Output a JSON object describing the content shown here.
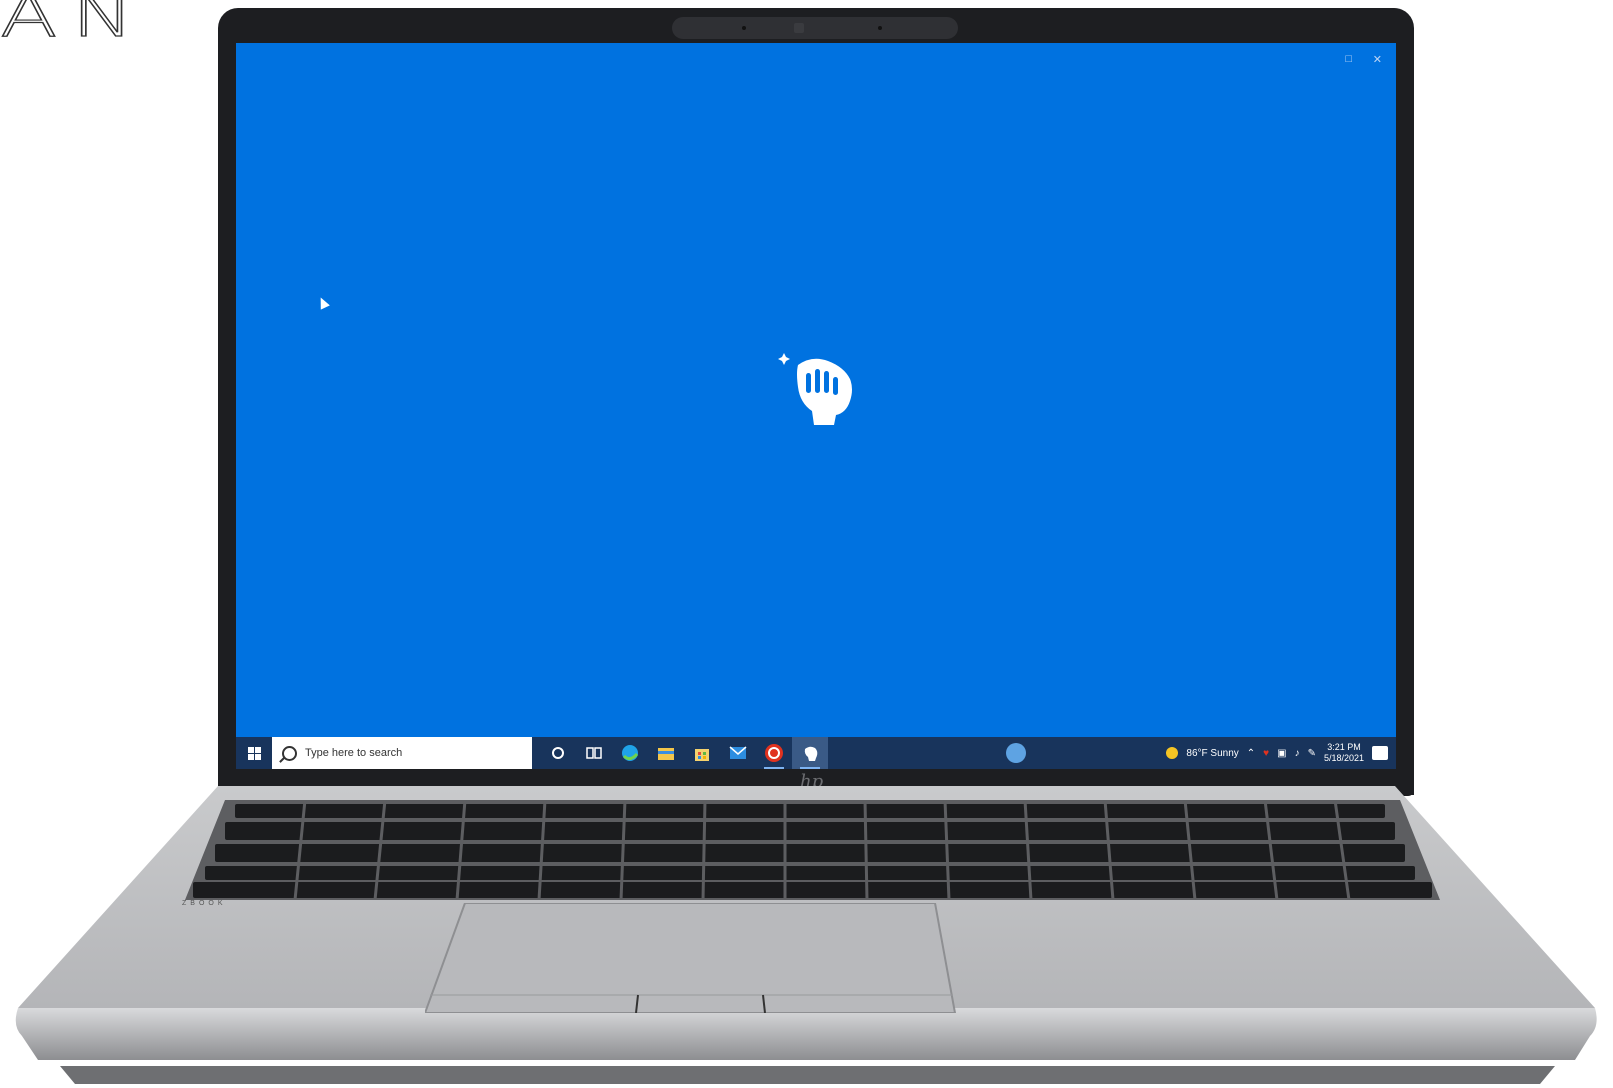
{
  "brand_fragment": "AN",
  "screen": {
    "background_color": "#0072e0",
    "window_controls": [
      "restore-icon",
      "close-icon"
    ],
    "center_icon": "clean-hand-icon"
  },
  "taskbar": {
    "search_placeholder": "Type here to search",
    "apps": [
      {
        "icon": "cortana-icon"
      },
      {
        "icon": "task-view-icon"
      },
      {
        "icon": "edge-icon"
      },
      {
        "icon": "file-explorer-icon"
      },
      {
        "icon": "store-icon"
      },
      {
        "icon": "mail-icon"
      },
      {
        "icon": "hp-app-icon"
      },
      {
        "icon": "clean-hand-icon",
        "active": true
      }
    ],
    "weather": "86°F Sunny",
    "clock_time": "3:21 PM",
    "clock_date": "5/18/2021"
  },
  "laptop": {
    "hp_logo": "hp",
    "zbook_label": "ZBOOK"
  }
}
